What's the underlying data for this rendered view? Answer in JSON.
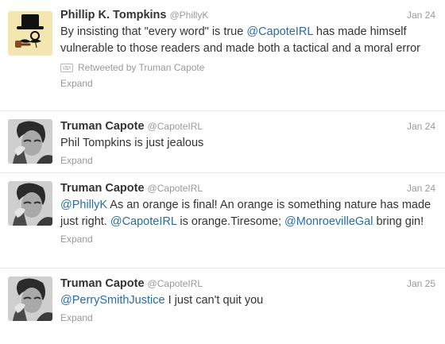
{
  "tweets": [
    {
      "name": "Phillip K. Tompkins",
      "handle": "@PhillyK",
      "date": "Jan 24",
      "text": [
        {
          "t": "By insisting that \"every word\" is true ",
          "m": false
        },
        {
          "t": "@CapoteIRL",
          "m": true
        },
        {
          "t": " has made himself vulnerable to those readers and made both a tactical and a moral error",
          "m": false
        }
      ],
      "retweet": "Retweeted by Truman Capote",
      "expand": "Expand",
      "avatar_icon": "monocle-hat-avatar"
    },
    {
      "name": "Truman Capote",
      "handle": "@CapoteIRL",
      "date": "Jan 24",
      "text": [
        {
          "t": "Phil Tompkins is just jealous",
          "m": false
        }
      ],
      "expand": "Expand",
      "avatar_icon": "capote-portrait-avatar"
    },
    {
      "name": "Truman Capote",
      "handle": "@CapoteIRL",
      "date": "Jan 24",
      "text": [
        {
          "t": "@PhillyK",
          "m": true
        },
        {
          "t": " As an orange is final! An orange is something nature has made just right. ",
          "m": false
        },
        {
          "t": "@CapoteIRL",
          "m": true
        },
        {
          "t": " is orange.Tiresome; ",
          "m": false
        },
        {
          "t": "@MonroevilleGal",
          "m": true
        },
        {
          "t": " bring gin!",
          "m": false
        }
      ],
      "expand": "Expand",
      "avatar_icon": "capote-portrait-avatar"
    },
    {
      "name": "Truman Capote",
      "handle": "@CapoteIRL",
      "date": "Jan 25",
      "text": [
        {
          "t": "@PerrySmithJustice",
          "m": true
        },
        {
          "t": " I just can't quit you",
          "m": false
        }
      ],
      "expand": "Expand",
      "avatar_icon": "capote-portrait-avatar"
    }
  ],
  "colors": {
    "mention": "#2a6ca3",
    "meta": "#999999",
    "text": "#333333",
    "avatar1_bg": "#f3e6b0"
  }
}
